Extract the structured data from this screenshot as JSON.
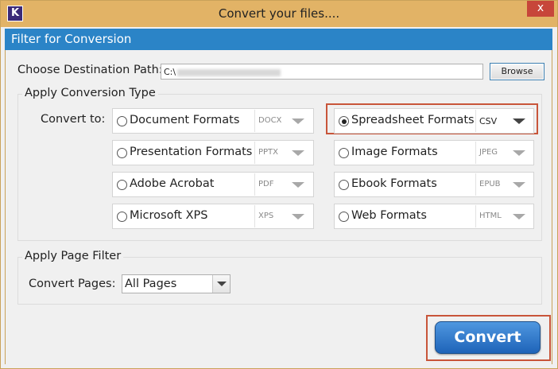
{
  "window": {
    "app_icon": "K",
    "title": "Convert your files....",
    "close_label": "x"
  },
  "header": {
    "title": "Filter for Conversion"
  },
  "destination": {
    "label": "Choose Destination Path:",
    "path_value": "C:\\",
    "browse_label": "Browse"
  },
  "conversion": {
    "group_title": "Apply Conversion Type",
    "convert_to_label": "Convert to:",
    "options": [
      {
        "label": "Document Formats",
        "format": "DOCX",
        "selected": false
      },
      {
        "label": "Presentation Formats",
        "format": "PPTX",
        "selected": false
      },
      {
        "label": "Adobe Acrobat",
        "format": "PDF",
        "selected": false
      },
      {
        "label": "Microsoft XPS",
        "format": "XPS",
        "selected": false
      },
      {
        "label": "Spreadsheet Formats",
        "format": "CSV",
        "selected": true
      },
      {
        "label": "Image Formats",
        "format": "JPEG",
        "selected": false
      },
      {
        "label": "Ebook Formats",
        "format": "EPUB",
        "selected": false
      },
      {
        "label": "Web Formats",
        "format": "HTML",
        "selected": false
      }
    ]
  },
  "page_filter": {
    "group_title": "Apply Page Filter",
    "label": "Convert Pages:",
    "value": "All Pages"
  },
  "actions": {
    "convert_label": "Convert"
  },
  "colors": {
    "titlebar": "#e2b366",
    "header_band": "#2b84c7",
    "highlight": "#c8553a",
    "convert_button": "#1e63b8"
  },
  "icons": {
    "app": "app-logo-icon",
    "close": "close-icon",
    "dropdown": "chevron-down-icon"
  }
}
